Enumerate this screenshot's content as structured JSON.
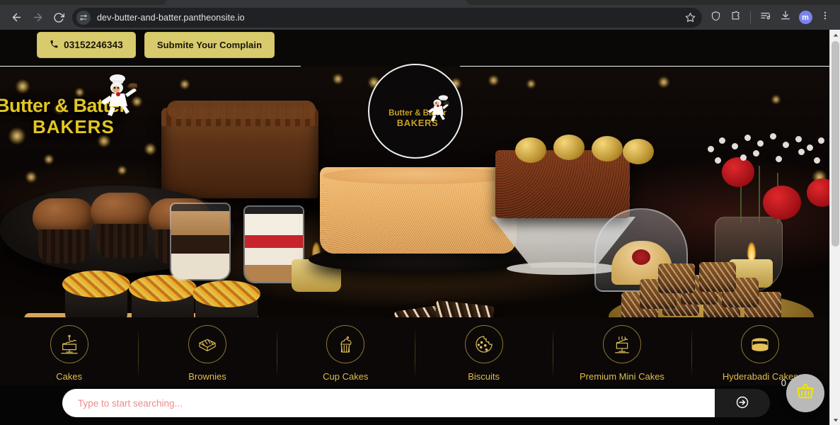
{
  "browser": {
    "back_icon": "back-arrow-icon",
    "forward_icon": "forward-arrow-icon",
    "reload_icon": "reload-icon",
    "site_info_icon": "site-settings-icon",
    "url": "dev-butter-and-batter.pantheonsite.io",
    "bookmark_icon": "star-icon",
    "shield_icon": "shield-icon",
    "extensions_icon": "extensions-puzzle-icon",
    "reading_list_icon": "reading-list-icon",
    "downloads_icon": "download-icon",
    "profile_initial": "m",
    "menu_icon": "three-dot-menu-icon"
  },
  "topnav": {
    "phone_label": "03152246343",
    "phone_icon": "phone-icon",
    "complaint_label": "Submite Your Complain",
    "button_color": "#d8cb6e"
  },
  "logo": {
    "line1": "Butter & Batter",
    "line2": "BAKERS",
    "mascot_icon": "chef-mascot-icon"
  },
  "hero": {
    "title_line1": "Butter & Batter",
    "title_line2": "BAKERS",
    "mascot_icon": "chef-mascot-icon",
    "accent_color": "#e3c623"
  },
  "categories": [
    {
      "label": "Cakes",
      "icon": "cake-stand-icon"
    },
    {
      "label": "Brownies",
      "icon": "brownie-icon"
    },
    {
      "label": "Cup Cakes",
      "icon": "cupcake-icon"
    },
    {
      "label": "Biscuits",
      "icon": "cookie-icon"
    },
    {
      "label": "Premium Mini Cakes",
      "icon": "mini-cake-icon"
    },
    {
      "label": "Hyderabadi Cakes",
      "icon": "hyderabadi-cake-icon"
    }
  ],
  "search": {
    "placeholder": "Type to start searching...",
    "value": "",
    "submit_icon": "arrow-right-circle-icon"
  },
  "cart": {
    "count": "0",
    "icon": "shopping-basket-icon"
  },
  "scrollbar": {
    "up_icon": "scroll-up-icon",
    "down_icon": "scroll-down-icon"
  }
}
